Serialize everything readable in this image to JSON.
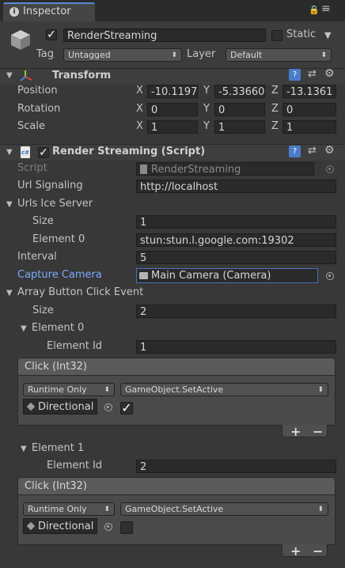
{
  "tab": {
    "title": "Inspector"
  },
  "gameobject": {
    "name": "RenderStreaming",
    "static_label": "Static",
    "tag_label": "Tag",
    "tag_value": "Untagged",
    "layer_label": "Layer",
    "layer_value": "Default"
  },
  "transform": {
    "title": "Transform",
    "position": {
      "label": "Position",
      "x": "-10.1197",
      "y": "-5.33660",
      "z": "-13.1361"
    },
    "rotation": {
      "label": "Rotation",
      "x": "0",
      "y": "0",
      "z": "0"
    },
    "scale": {
      "label": "Scale",
      "x": "1",
      "y": "1",
      "z": "1"
    },
    "axis": {
      "x": "X",
      "y": "Y",
      "z": "Z"
    }
  },
  "script_component": {
    "title": "Render Streaming (Script)",
    "script_label": "Script",
    "script_value": "RenderStreaming",
    "url_label": "Url Signaling",
    "url_value": "http://localhost",
    "ice_label": "Urls Ice Server",
    "ice_size_label": "Size",
    "ice_size_value": "1",
    "ice_el0_label": "Element 0",
    "ice_el0_value": "stun:stun.l.google.com:19302",
    "interval_label": "Interval",
    "interval_value": "5",
    "camera_label": "Capture Camera",
    "camera_value": "Main Camera (Camera)",
    "array_label": "Array Button Click Event",
    "array_size_label": "Size",
    "array_size_value": "2"
  },
  "elements": [
    {
      "label": "Element 0",
      "id_label": "Element Id",
      "id_value": "1",
      "event_title": "Click (Int32)",
      "runtime": "Runtime Only",
      "function": "GameObject.SetActive",
      "object": "Directional",
      "checked": "✓"
    },
    {
      "label": "Element 1",
      "id_label": "Element Id",
      "id_value": "2",
      "event_title": "Click (Int32)",
      "runtime": "Runtime Only",
      "function": "GameObject.SetActive",
      "object": "Directional",
      "checked": ""
    }
  ],
  "icons": {
    "plus": "+",
    "minus": "−",
    "check": "✓",
    "lock": "lock-icon",
    "menu": "menu-icon"
  },
  "colors": {
    "bg": "#383838",
    "tab": "#454545",
    "field": "#2a2a2a",
    "link": "#7ea8ff",
    "selected_border": "#4b70c4"
  }
}
